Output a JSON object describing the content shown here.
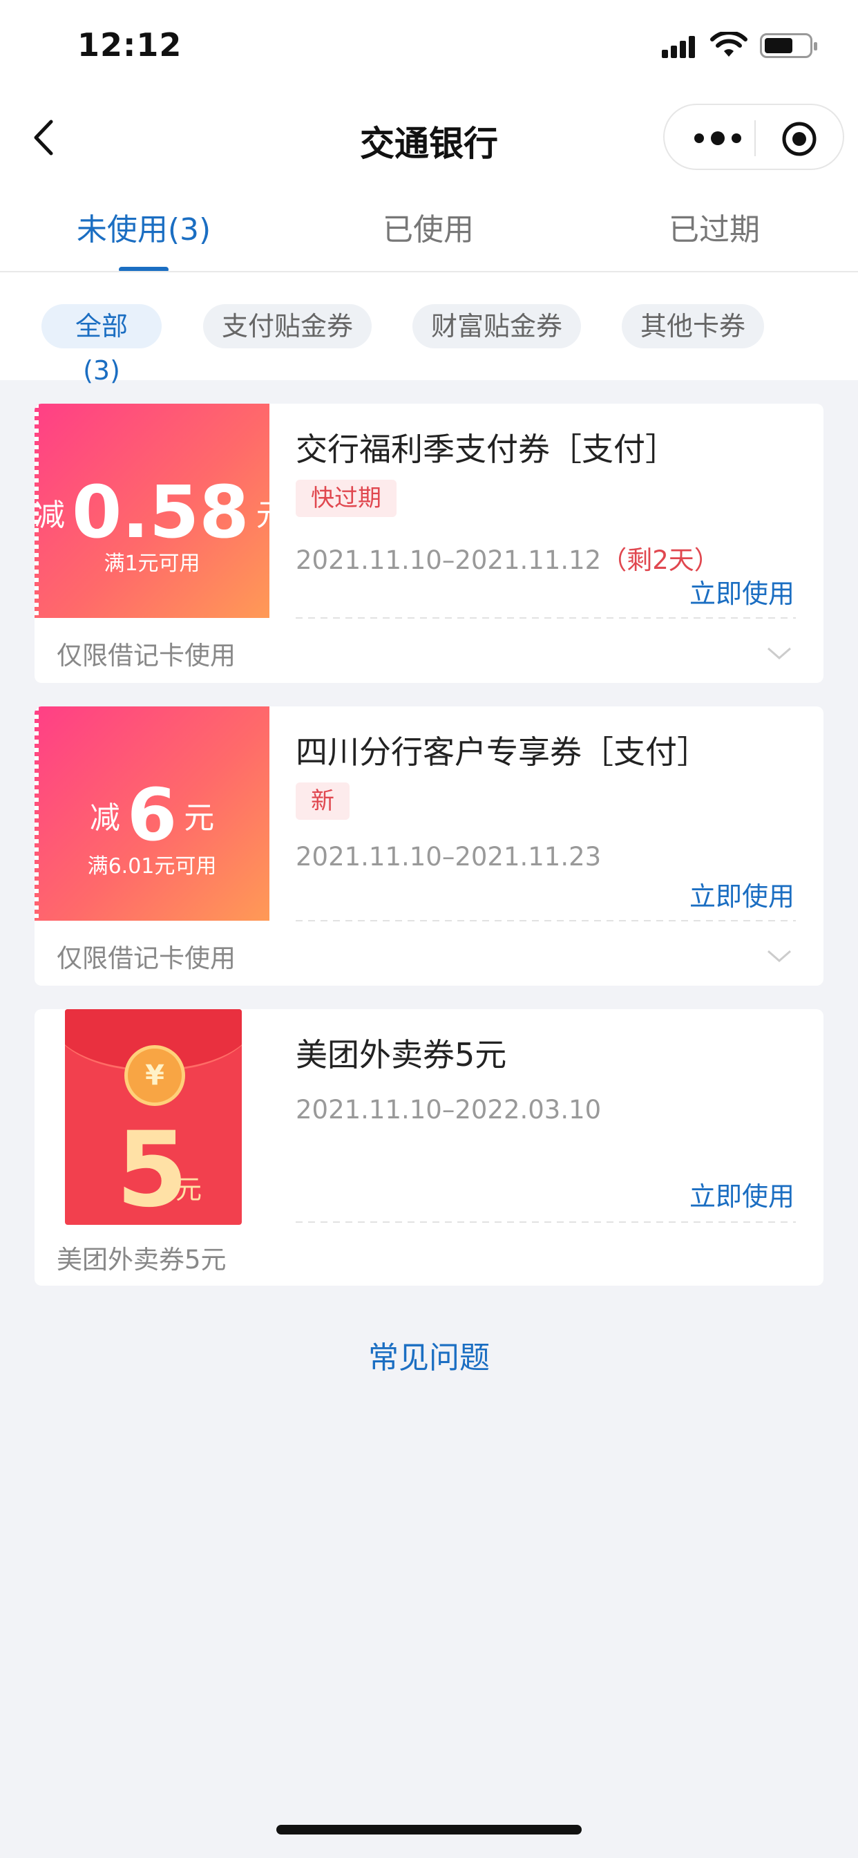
{
  "status_bar": {
    "time": "12:12"
  },
  "nav": {
    "title": "交通银行"
  },
  "tabs": [
    {
      "label": "未使用(3)",
      "active": true
    },
    {
      "label": "已使用",
      "active": false
    },
    {
      "label": "已过期",
      "active": false
    }
  ],
  "filters": [
    {
      "label": "全部(3)",
      "active": true
    },
    {
      "label": "支付贴金券",
      "active": false
    },
    {
      "label": "财富贴金券",
      "active": false
    },
    {
      "label": "其他卡券",
      "active": false
    }
  ],
  "coupons": [
    {
      "prefix": "减",
      "amount": "0.58",
      "unit": "元",
      "condition": "满1元可用",
      "title": "交行福利季支付券［支付］",
      "tag": "快过期",
      "date": "2021.11.10–2021.11.12",
      "remain": "（剩2天）",
      "action": "立即使用",
      "footer": "仅限借记卡使用"
    },
    {
      "prefix": "减",
      "amount": "6",
      "unit": "元",
      "condition": "满6.01元可用",
      "title": "四川分行客户专享券［支付］",
      "tag": "新",
      "date": "2021.11.10–2021.11.23",
      "action": "立即使用",
      "footer": "仅限借记卡使用"
    },
    {
      "amount": "5",
      "unit": "元",
      "coin": "¥",
      "title": "美团外卖券5元",
      "date": "2021.11.10–2022.03.10",
      "action": "立即使用",
      "footer": "美团外卖券5元"
    }
  ],
  "faq": "常见问题",
  "colors": {
    "accent": "#1b6ec2",
    "warning": "#e0474f",
    "background": "#f2f3f7"
  }
}
